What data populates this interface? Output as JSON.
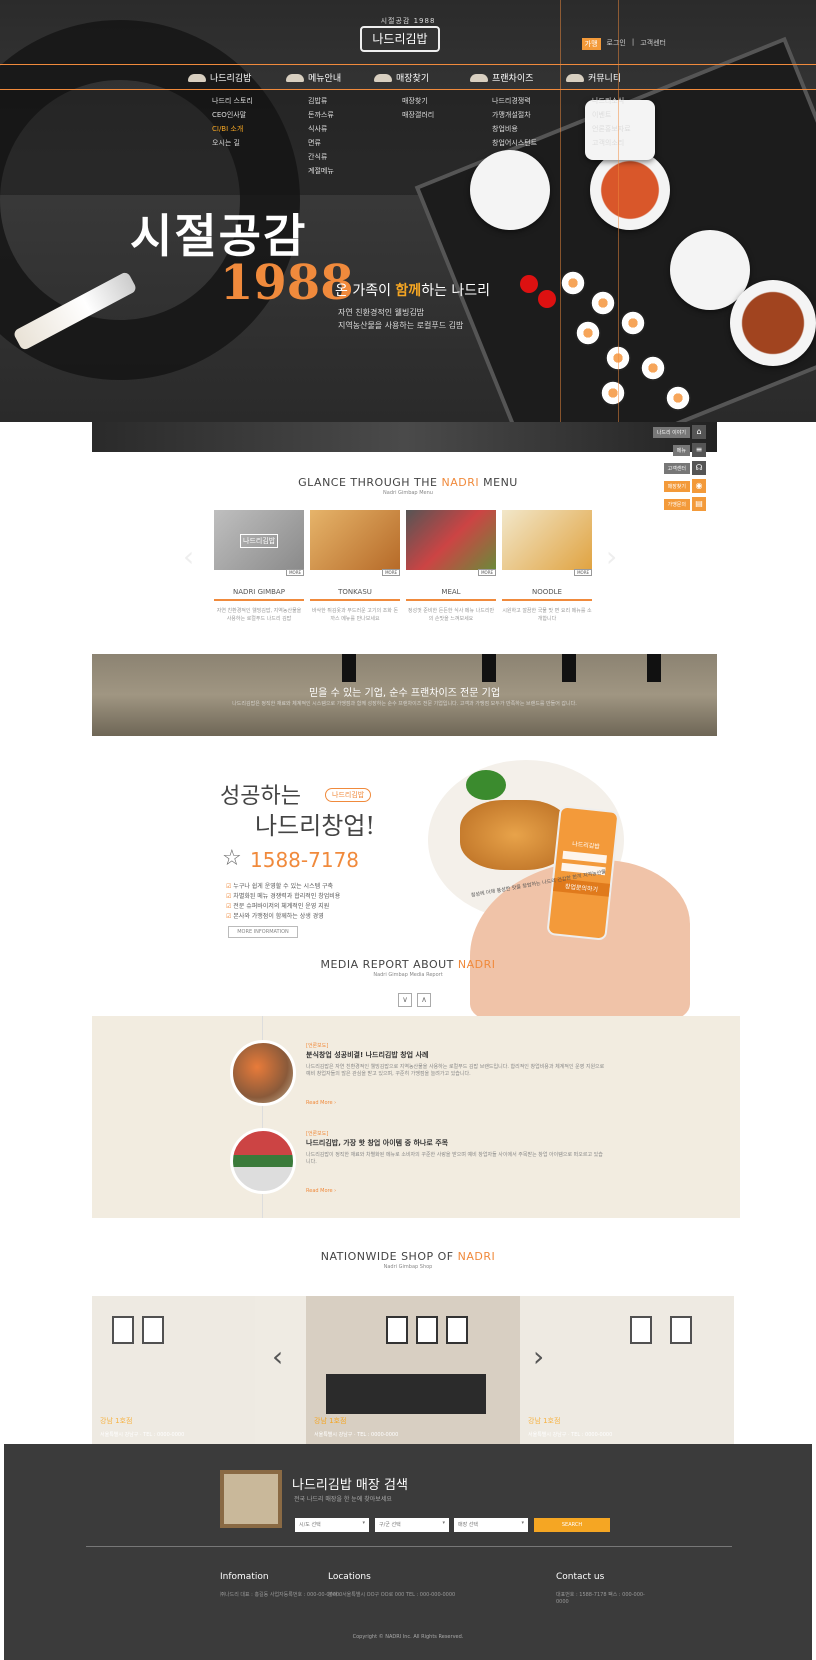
{
  "header": {
    "logo_top": "시절공감 1988",
    "logo": "나드리김밥",
    "util_flag": "가맹",
    "util_links": [
      "로그인",
      "고객센터"
    ]
  },
  "nav": {
    "items": [
      {
        "label": "나드리김밥",
        "sub": [
          "나드리 스토리",
          "CEO인사말",
          "CI/BI 소개",
          "오시는 길"
        ],
        "highlight": 2
      },
      {
        "label": "메뉴안내",
        "sub": [
          "김밥류",
          "돈까스류",
          "식사류",
          "면류",
          "간식류",
          "계절메뉴"
        ],
        "highlight": -1
      },
      {
        "label": "매장찾기",
        "sub": [
          "매장찾기",
          "매장갤러리"
        ],
        "highlight": -1
      },
      {
        "label": "프랜차이즈",
        "sub": [
          "나드리경쟁력",
          "가맹개설절차",
          "창업비용",
          "창업어시스턴트"
        ],
        "highlight": -1
      },
      {
        "label": "커뮤니티",
        "sub": [
          "나드리소식",
          "이벤트",
          "언론홍보자료",
          "고객의소리"
        ],
        "highlight": -1
      }
    ]
  },
  "hero": {
    "slogan_1": "시절공감",
    "slogan_2": "1988",
    "tagline_pre": "온 가족이 ",
    "tagline_hl": "함께",
    "tagline_post": "하는 나드리",
    "sub_1": "자연 친환경적인 웰빙김밥",
    "sub_2": "지역농산물을 사용하는 로컬푸드 김밥"
  },
  "quick": [
    {
      "label": "나드리 이야기",
      "icon": "gift-icon",
      "orange": false
    },
    {
      "label": "메뉴",
      "icon": "menu-icon",
      "orange": false
    },
    {
      "label": "고객센터",
      "icon": "headset-icon",
      "orange": false
    },
    {
      "label": "매장찾기",
      "icon": "pin-icon",
      "orange": true
    },
    {
      "label": "가맹문의",
      "icon": "doc-icon",
      "orange": true
    }
  ],
  "menu_section": {
    "title_pre": "GLANCE THROUGH THE ",
    "title_hl": "NADRI",
    "title_post": " MENU",
    "sub": "Nadri Gimbap Menu",
    "more": "MORE",
    "cards": [
      {
        "name": "NADRI GIMBAP",
        "desc": "자연 친환경적인 웰빙김밥, 지역농산물을 사용하는 로컬푸드 나드리 김밥",
        "badge": "나드리김밥"
      },
      {
        "name": "TONKASU",
        "desc": "바삭한 튀김옷과 부드러운 고기의 조화 돈까스 메뉴를 만나보세요",
        "badge": ""
      },
      {
        "name": "MEAL",
        "desc": "정성껏 준비한 든든한 식사 메뉴 나드리만의 손맛을 느껴보세요",
        "badge": ""
      },
      {
        "name": "NOODLE",
        "desc": "시원하고 깔끔한 국물 맛 면 요리 메뉴를 소개합니다",
        "badge": ""
      }
    ]
  },
  "franchise": {
    "title": "믿을 수 있는 기업, 순수 프랜차이즈 전문 기업",
    "desc": "나드리김밥은 정직한 재료와 체계적인 시스템으로 가맹점과 함께 성장하는 순수 프랜차이즈 전문 기업입니다. 고객과 가맹점 모두가 만족하는 브랜드를 만들어 갑니다."
  },
  "startup": {
    "badge": "나드리김밥",
    "t1": "성공하는",
    "t2": "나드리창업!",
    "phone": "1588-7178",
    "bullets": [
      "누구나 쉽게 운영할 수 있는 시스템 구축",
      "차별화된 메뉴 경쟁력과 합리적인 창업비용",
      "전문 슈퍼바이저의 체계적인 운영 지원",
      "본사와 가맹점이 함께하는 상생 경영"
    ],
    "button": "MORE INFORMATION",
    "phone_title": "나드리김밥",
    "phone_btn": "창업문의하기",
    "note": "정성에 더해 풍성한 맛을 창업하는 나드리\n건강한 한끼 지역농산물"
  },
  "media": {
    "title_pre": "MEDIA REPORT ABOUT ",
    "title_hl": "NADRI",
    "sub": "Nadri Gimbap Media Report",
    "items": [
      {
        "tag": "[언론보도]",
        "title": "분식창업 성공비결! 나드리김밥 창업 사례",
        "text": "나드리김밥은 자연 친환경적인 웰빙김밥으로 지역농산물을 사용하는 로컬푸드 김밥 브랜드입니다. 합리적인 창업비용과 체계적인 운영 지원으로 예비 창업자들의 많은 관심을 받고 있으며, 꾸준히 가맹점을 늘려가고 있습니다.",
        "more": "Read More ›"
      },
      {
        "tag": "[언론보도]",
        "title": "나드리김밥, 가장 핫 창업 아이템 중 하나로 주목",
        "text": "나드리김밥이 정직한 재료와 차별화된 메뉴로 소비자의 꾸준한 사랑을 받으며 예비 창업자들 사이에서 주목받는 창업 아이템으로 떠오르고 있습니다.",
        "more": "Read More ›"
      }
    ]
  },
  "shops": {
    "title_pre": "NATIONWIDE SHOP OF ",
    "title_hl": "NADRI",
    "sub": "Nadri Gimbap Shop",
    "items": [
      {
        "name": "강남 1호점",
        "addr": "서울특별시 강남구 · TEL : 0000-0000"
      },
      {
        "name": "강남 1호점",
        "addr": "서울특별시 강남구 · TEL : 0000-0000"
      },
      {
        "name": "강남 1호점",
        "addr": "서울특별시 강남구 · TEL : 0000-0000"
      }
    ]
  },
  "footer": {
    "title": "나드리김밥 매장 검색",
    "sub": "전국 나드리 매장을 한 눈에 찾아보세요",
    "selects": [
      "시/도 선택",
      "구/군 선택",
      "매장 선택"
    ],
    "search": "SEARCH",
    "info_h": "Infomation",
    "info_t": "㈜나드리 대표 : 홍길동 사업자등록번호 : 000-00-00000",
    "loc_h": "Locations",
    "loc_t": "본사 : 서울특별시 OO구 OO로 000 TEL : 000-000-0000",
    "contact_h": "Contact us",
    "contact_t": "대표번호 : 1588-7178 팩스 : 000-000-0000",
    "copyright": "Copyright © NADRI Inc. All Rights Reserved."
  },
  "colors": {
    "accent": "#f08a3c",
    "highlight": "#f5a623",
    "dark": "#3b3b3b"
  }
}
